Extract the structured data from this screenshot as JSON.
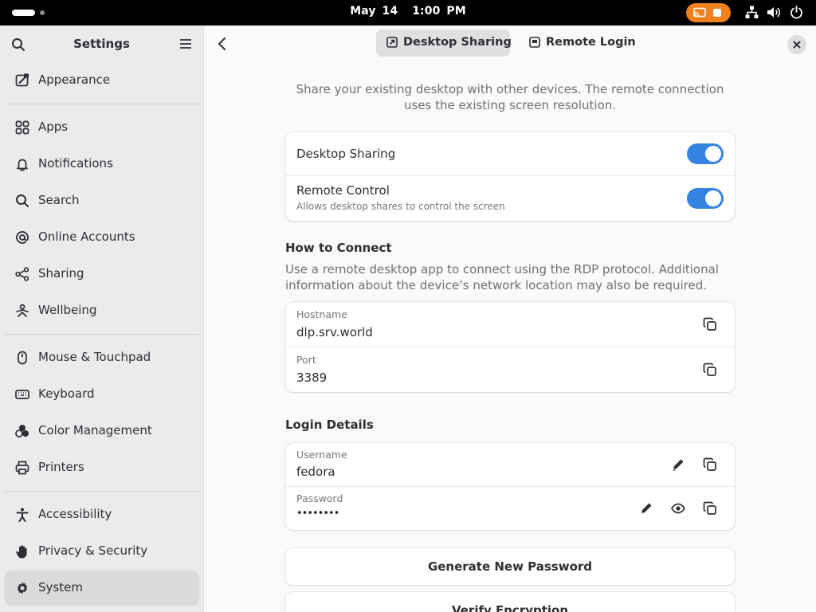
{
  "topbar": {
    "date": "May 14",
    "time": "1:00 PM",
    "recording_color": "#f0811e"
  },
  "sidebar": {
    "title": "Settings",
    "items": [
      {
        "label": "Appearance",
        "icon": "appearance-icon"
      },
      {
        "label": "Apps",
        "icon": "apps-grid-icon"
      },
      {
        "label": "Notifications",
        "icon": "bell-icon"
      },
      {
        "label": "Search",
        "icon": "search-icon"
      },
      {
        "label": "Online Accounts",
        "icon": "at-sign-icon"
      },
      {
        "label": "Sharing",
        "icon": "share-icon"
      },
      {
        "label": "Wellbeing",
        "icon": "wellbeing-icon"
      },
      {
        "label": "Mouse & Touchpad",
        "icon": "mouse-icon"
      },
      {
        "label": "Keyboard",
        "icon": "keyboard-icon"
      },
      {
        "label": "Color Management",
        "icon": "color-circles-icon"
      },
      {
        "label": "Printers",
        "icon": "printer-icon"
      },
      {
        "label": "Accessibility",
        "icon": "accessibility-icon"
      },
      {
        "label": "Privacy & Security",
        "icon": "hand-icon"
      },
      {
        "label": "System",
        "icon": "gear-icon",
        "selected": true
      }
    ]
  },
  "header": {
    "tabs": [
      {
        "label": "Desktop Sharing",
        "icon": "desktop-sharing-icon",
        "active": true
      },
      {
        "label": "Remote Login",
        "icon": "remote-login-icon",
        "active": false
      }
    ]
  },
  "main": {
    "intro": "Share your existing desktop with other devices. The remote connection uses the existing screen resolution.",
    "toggles": [
      {
        "title": "Desktop Sharing",
        "subtitle": "",
        "on": true
      },
      {
        "title": "Remote Control",
        "subtitle": "Allows desktop shares to control the screen",
        "on": true
      }
    ],
    "how_to_connect": {
      "title": "How to Connect",
      "description": "Use a remote desktop app to connect using the RDP protocol. Additional information about the device’s network location may also be required.",
      "hostname_label": "Hostname",
      "hostname_value": "dlp.srv.world",
      "port_label": "Port",
      "port_value": "3389"
    },
    "login_details": {
      "title": "Login Details",
      "username_label": "Username",
      "username_value": "fedora",
      "password_label": "Password",
      "password_value": "••••••••"
    },
    "generate_button": "Generate New Password",
    "verify_button": "Verify Encryption"
  },
  "colors": {
    "accent": "#3584e4",
    "sidebar_bg": "#ebebed",
    "content_bg": "#fafafb"
  }
}
